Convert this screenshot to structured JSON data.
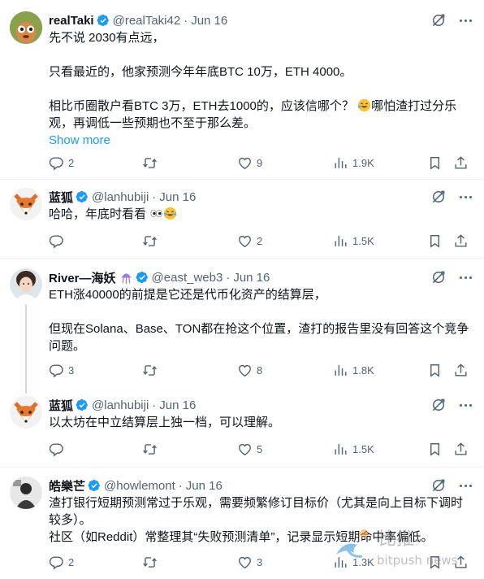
{
  "tweets": [
    {
      "name": "realTaki",
      "handle": "@realTaki42",
      "date": "Jun 16",
      "lines": [
        "先不说 2030有点远，",
        "",
        "只看最近的，他家预测今年年底BTC 10万，ETH 4000。",
        "",
        "相比币圈散户看BTC 3万，ETH去1000的，应该信哪个？",
        "哪怕渣打过分乐观，再调低一些预期也不至于那么差。"
      ],
      "show_more": "Show more",
      "replies": "2",
      "retweets": "",
      "likes": "9",
      "views": "1.9K"
    },
    {
      "name": "蓝狐",
      "handle": "@lanhubiji",
      "date": "Jun 16",
      "line1": "哈哈，年底时看看",
      "replies": "",
      "retweets": "",
      "likes": "2",
      "views": "1.5K"
    },
    {
      "name": "River—海妖",
      "handle": "@east_web3",
      "date": "Jun 16",
      "lines": [
        "ETH涨40000的前提是它还是代币化资产的结算层，",
        "",
        "但现在Solana、Base、TON都在抢这个位置，渣打的报告里没有回答这个竞争",
        "问题。"
      ],
      "replies": "3",
      "retweets": "",
      "likes": "8",
      "views": "1.8K"
    },
    {
      "name": "蓝狐",
      "handle": "@lanhubiji",
      "date": "Jun 16",
      "lines": [
        "以太坊在中立结算层上独一档，可以理解。"
      ],
      "replies": "",
      "retweets": "",
      "likes": "5",
      "views": "1.5K"
    },
    {
      "name": "皓樂芒",
      "handle": "@howlemont",
      "date": "Jun 16",
      "lines": [
        "渣打银行短期预测常过于乐观，需要频繁修订目标价（尤其是向上目标下调时",
        "较多）。",
        "社区（如Reddit）常整理其“失败预测清单”，记录显示短期命中率偏低。"
      ],
      "replies": "2",
      "retweets": "",
      "likes": "3",
      "views": "1.3K"
    }
  ],
  "watermark": {
    "cn": "比推",
    "en": "bitpush news"
  },
  "colors": {
    "verified": "#1d9bf0",
    "link": "#1d9bf0",
    "muted": "#536471",
    "divider": "#eff3f4"
  },
  "icons": [
    "grok-icon",
    "more-icon",
    "reply-icon",
    "retweet-icon",
    "like-icon",
    "views-icon",
    "bookmark-icon",
    "share-icon",
    "verified-badge-icon"
  ]
}
